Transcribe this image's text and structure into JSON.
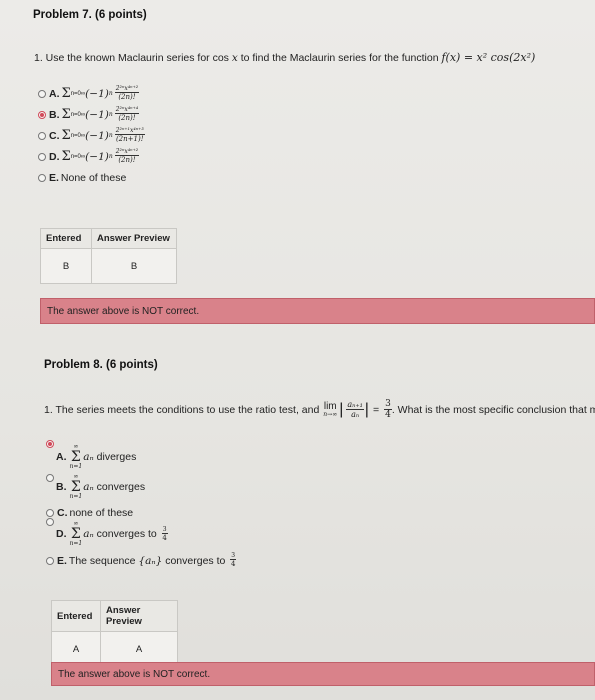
{
  "problem7": {
    "title": "Problem 7. (6 points)",
    "question_prefix": "1. Use the known Maclaurin series for cos",
    "question_var": "x",
    "question_mid": "to find the Maclaurin series for the function",
    "question_func": "f(x) = x² cos(2x²)",
    "options": [
      {
        "label": "A.",
        "sum": "Σ",
        "sub": "n=0",
        "sup": "∞",
        "base": "(−1)",
        "exp": "n",
        "num": "2²ⁿx⁴ⁿ⁺²",
        "den": "(2n)!",
        "selected": false
      },
      {
        "label": "B.",
        "sum": "Σ",
        "sub": "n=0",
        "sup": "∞",
        "base": "(−1)",
        "exp": "n",
        "num": "2²ⁿx⁴ⁿ⁺⁴",
        "den": "(2n)!",
        "selected": true
      },
      {
        "label": "C.",
        "sum": "Σ",
        "sub": "n=0",
        "sup": "∞",
        "base": "(−1)",
        "exp": "n",
        "num": "2²ⁿ⁺¹x⁴ⁿ⁺³",
        "den": "(2n+1)!",
        "selected": false
      },
      {
        "label": "D.",
        "sum": "Σ",
        "sub": "n=0",
        "sup": "∞",
        "base": "(−1)",
        "exp": "n",
        "num": "2²ⁿx⁴ⁿ⁺²",
        "den": "(2n)!",
        "selected": false
      },
      {
        "label": "E.",
        "text": "None of these",
        "selected": false
      }
    ],
    "table": {
      "col1": "Entered",
      "col2": "Answer Preview",
      "entered": "B",
      "preview": "B"
    },
    "status": "The answer above is NOT correct."
  },
  "problem8": {
    "title": "Problem 8. (6 points)",
    "question_prefix": "1. The series meets the conditions to use the ratio test, and",
    "lim": "lim",
    "lim_sub": "n→∞",
    "ratio_num": "aₙ₊₁",
    "ratio_den": "aₙ",
    "eq": "=",
    "frac_num": "3",
    "frac_den": "4",
    "question_suffix": ". What is the most specific conclusion that ma",
    "options": [
      {
        "label": "A.",
        "sup": "∞",
        "sub": "n=1",
        "term": "aₙ",
        "text": "diverges",
        "selected": true
      },
      {
        "label": "B.",
        "sup": "∞",
        "sub": "n=1",
        "term": "aₙ",
        "text": "converges",
        "selected": false
      },
      {
        "label": "C.",
        "text": "none of these",
        "selected": false
      },
      {
        "label": "D.",
        "sup": "∞",
        "sub": "n=1",
        "term": "aₙ",
        "text": "converges to",
        "fnum": "3",
        "fden": "4",
        "selected": false
      },
      {
        "label": "E.",
        "text": "The sequence",
        "seq": "{aₙ}",
        "text2": "converges to",
        "fnum": "3",
        "fden": "4",
        "selected": false
      }
    ],
    "table": {
      "col1": "Entered",
      "col2": "Answer Preview",
      "entered": "A",
      "preview": "A"
    },
    "status": "The answer above is NOT correct."
  },
  "colors": {
    "selected_radio": "#d14a5a",
    "status_bar": "#d9828a"
  }
}
